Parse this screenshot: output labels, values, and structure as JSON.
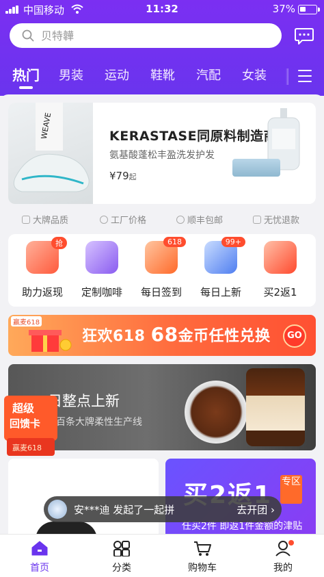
{
  "status_bar": {
    "carrier": "中国移动",
    "time": "11:32",
    "battery": "37%",
    "battery_level": 0.37
  },
  "search": {
    "placeholder": "贝特韡"
  },
  "tabs": [
    {
      "label": "热门",
      "active": true
    },
    {
      "label": "男装"
    },
    {
      "label": "运动"
    },
    {
      "label": "鞋靴"
    },
    {
      "label": "汽配"
    },
    {
      "label": "女装"
    }
  ],
  "hero": {
    "brand": "KERASTASE同原料制造商",
    "subtitle": "氨基酸蓬松丰盈洗发护发",
    "price": "¥79",
    "price_suffix": "起"
  },
  "features": [
    {
      "label": "大牌品质",
      "icon": "diamond-icon"
    },
    {
      "label": "工厂价格",
      "icon": "yen-coin-icon"
    },
    {
      "label": "顺丰包邮",
      "icon": "sf-express-icon"
    },
    {
      "label": "无忧退款",
      "icon": "shield-check-icon"
    }
  ],
  "shortcuts": [
    {
      "label": "助力返现",
      "badge": "抢",
      "color": "#ff6b4a",
      "icon": "red-packet-icon"
    },
    {
      "label": "定制咖啡",
      "badge": "",
      "color": "#9a6cf0",
      "icon": "coffee-cup-icon"
    },
    {
      "label": "每日签到",
      "badge": "618",
      "color": "#ff7e3b",
      "icon": "calendar-check-icon"
    },
    {
      "label": "每日上新",
      "badge": "99+",
      "color": "#5a8af5",
      "icon": "new-store-icon"
    },
    {
      "label": "买2返1",
      "badge": "",
      "color": "#ff5a3c",
      "icon": "return-gift-icon"
    }
  ],
  "promo": {
    "tag": "赢麦618",
    "text": "狂欢618 ",
    "highlight": "68",
    "text_tail": "金币任性兑换",
    "cta": "GO"
  },
  "banner2": {
    "title": "日整点上新",
    "subtitle": "百条大牌柔性生产线",
    "stamp_line1": "超级",
    "stamp_line2": "回馈卡",
    "stamp_tag": "赢麦618"
  },
  "card_right": {
    "big": "买2返1",
    "tag": "专区",
    "small": "任买2件 即返1件金额的津贴"
  },
  "group_toast": {
    "message": "安***迪 发起了一起拼",
    "action": "去开团"
  },
  "bottom_nav": [
    {
      "label": "首页",
      "active": true,
      "icon": "home-icon"
    },
    {
      "label": "分类",
      "icon": "grid-icon"
    },
    {
      "label": "购物车",
      "icon": "cart-icon"
    },
    {
      "label": "我的",
      "icon": "profile-icon"
    }
  ],
  "colors": {
    "brand": "#6a34ee",
    "accent": "#ff4d2e"
  }
}
